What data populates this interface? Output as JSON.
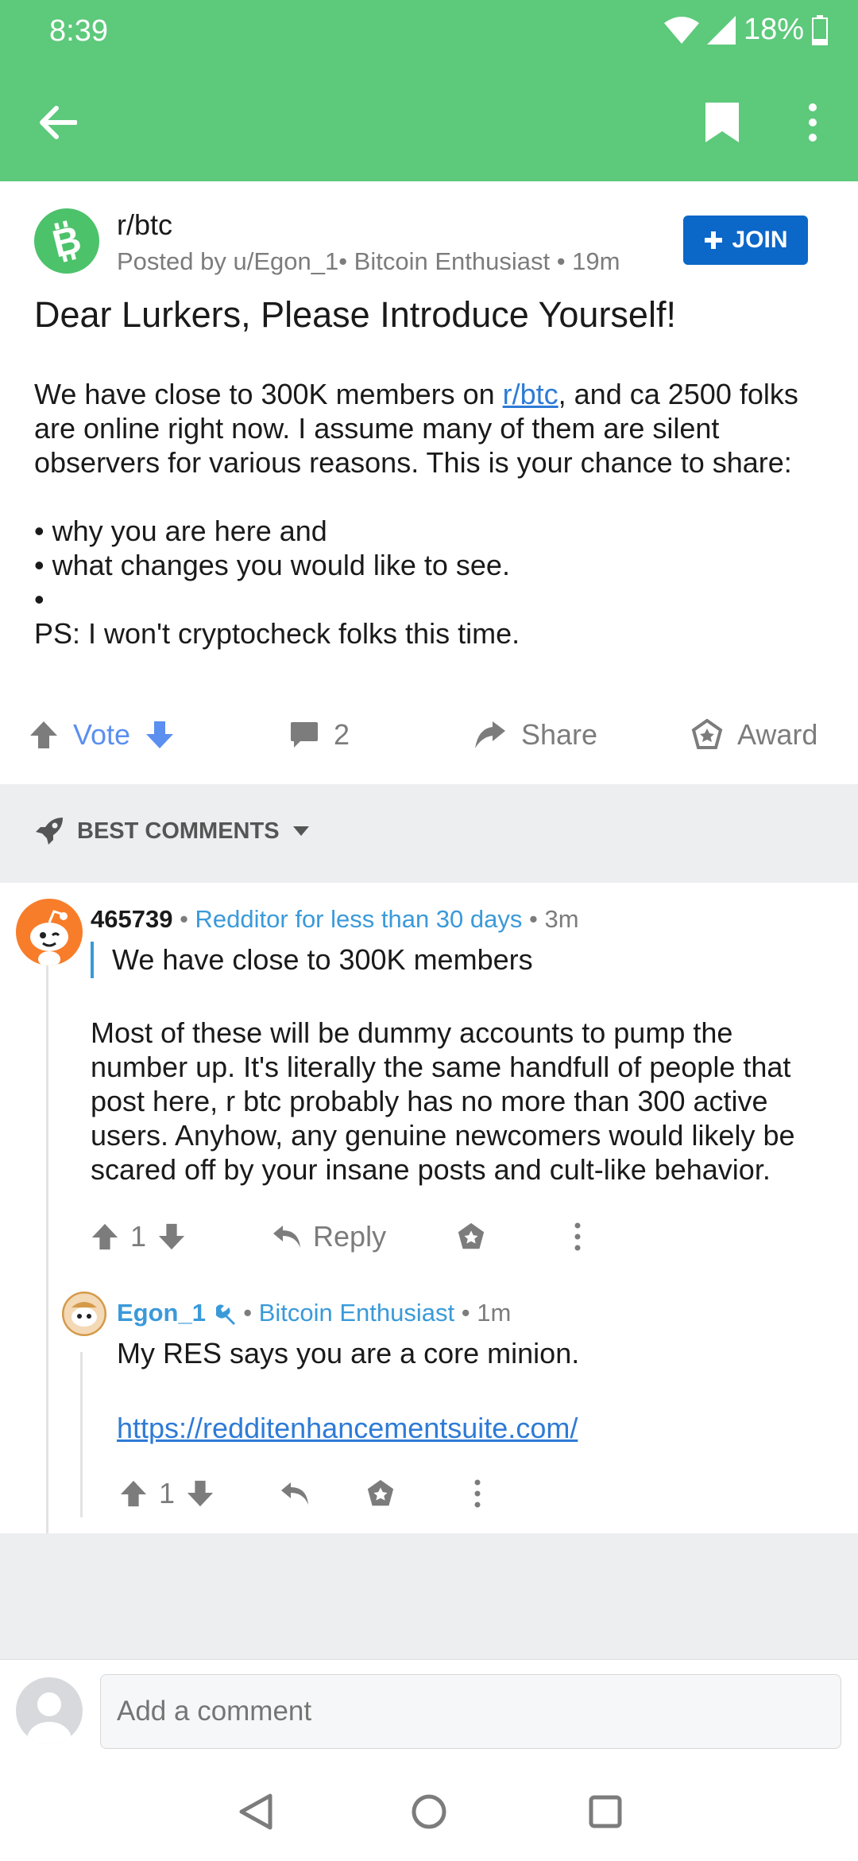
{
  "status": {
    "time": "8:39",
    "battery": "18%"
  },
  "appbar": {
    "back_icon": "arrow-left-icon",
    "bookmark_icon": "bookmark-icon",
    "more_icon": "more-vertical-icon"
  },
  "post": {
    "subreddit": "r/btc",
    "meta": "Posted by u/Egon_1• Bitcoin Enthusiast • 19m",
    "join_label": "JOIN",
    "title": "Dear Lurkers, Please Introduce Yourself!",
    "body_p1_pre": "We have close to 300K members on ",
    "body_p1_link": "r/btc",
    "body_p1_post": ", and ca 2500 folks are online right now. I assume many of them are silent observers for various reasons. This is your chance to share:",
    "bullets": [
      "• why you are here and",
      "• what changes you would like to see.",
      "•"
    ],
    "ps": "PS: I won't cryptocheck folks this time."
  },
  "actions": {
    "vote": "Vote",
    "comments": "2",
    "share": "Share",
    "award": "Award"
  },
  "sort": {
    "label": "BEST COMMENTS"
  },
  "comment1": {
    "user": "465739",
    "flair": "Redditor for less than 30 days",
    "time": "3m",
    "quote": "We have close to 300K members",
    "body": "Most of these will be dummy accounts to pump the number up.  It's literally the same handfull of people that post here, r btc probably has no more than 300 active users.  Anyhow, any genuine newcomers would likely be scared off by your insane posts and cult-like behavior.",
    "score": "1",
    "reply": "Reply"
  },
  "comment2": {
    "user": "Egon_1",
    "flair": "Bitcoin Enthusiast",
    "time": "1m",
    "body": "My RES says you are a core minion.",
    "link": "https://redditenhancementsuite.com/",
    "score": "1"
  },
  "composer": {
    "placeholder": "Add a comment"
  },
  "colors": {
    "brand_green": "#5dc97b",
    "join_blue": "#0b67c8",
    "flair_blue": "#3a9ad9",
    "vote_blue": "#5b8ff0"
  }
}
